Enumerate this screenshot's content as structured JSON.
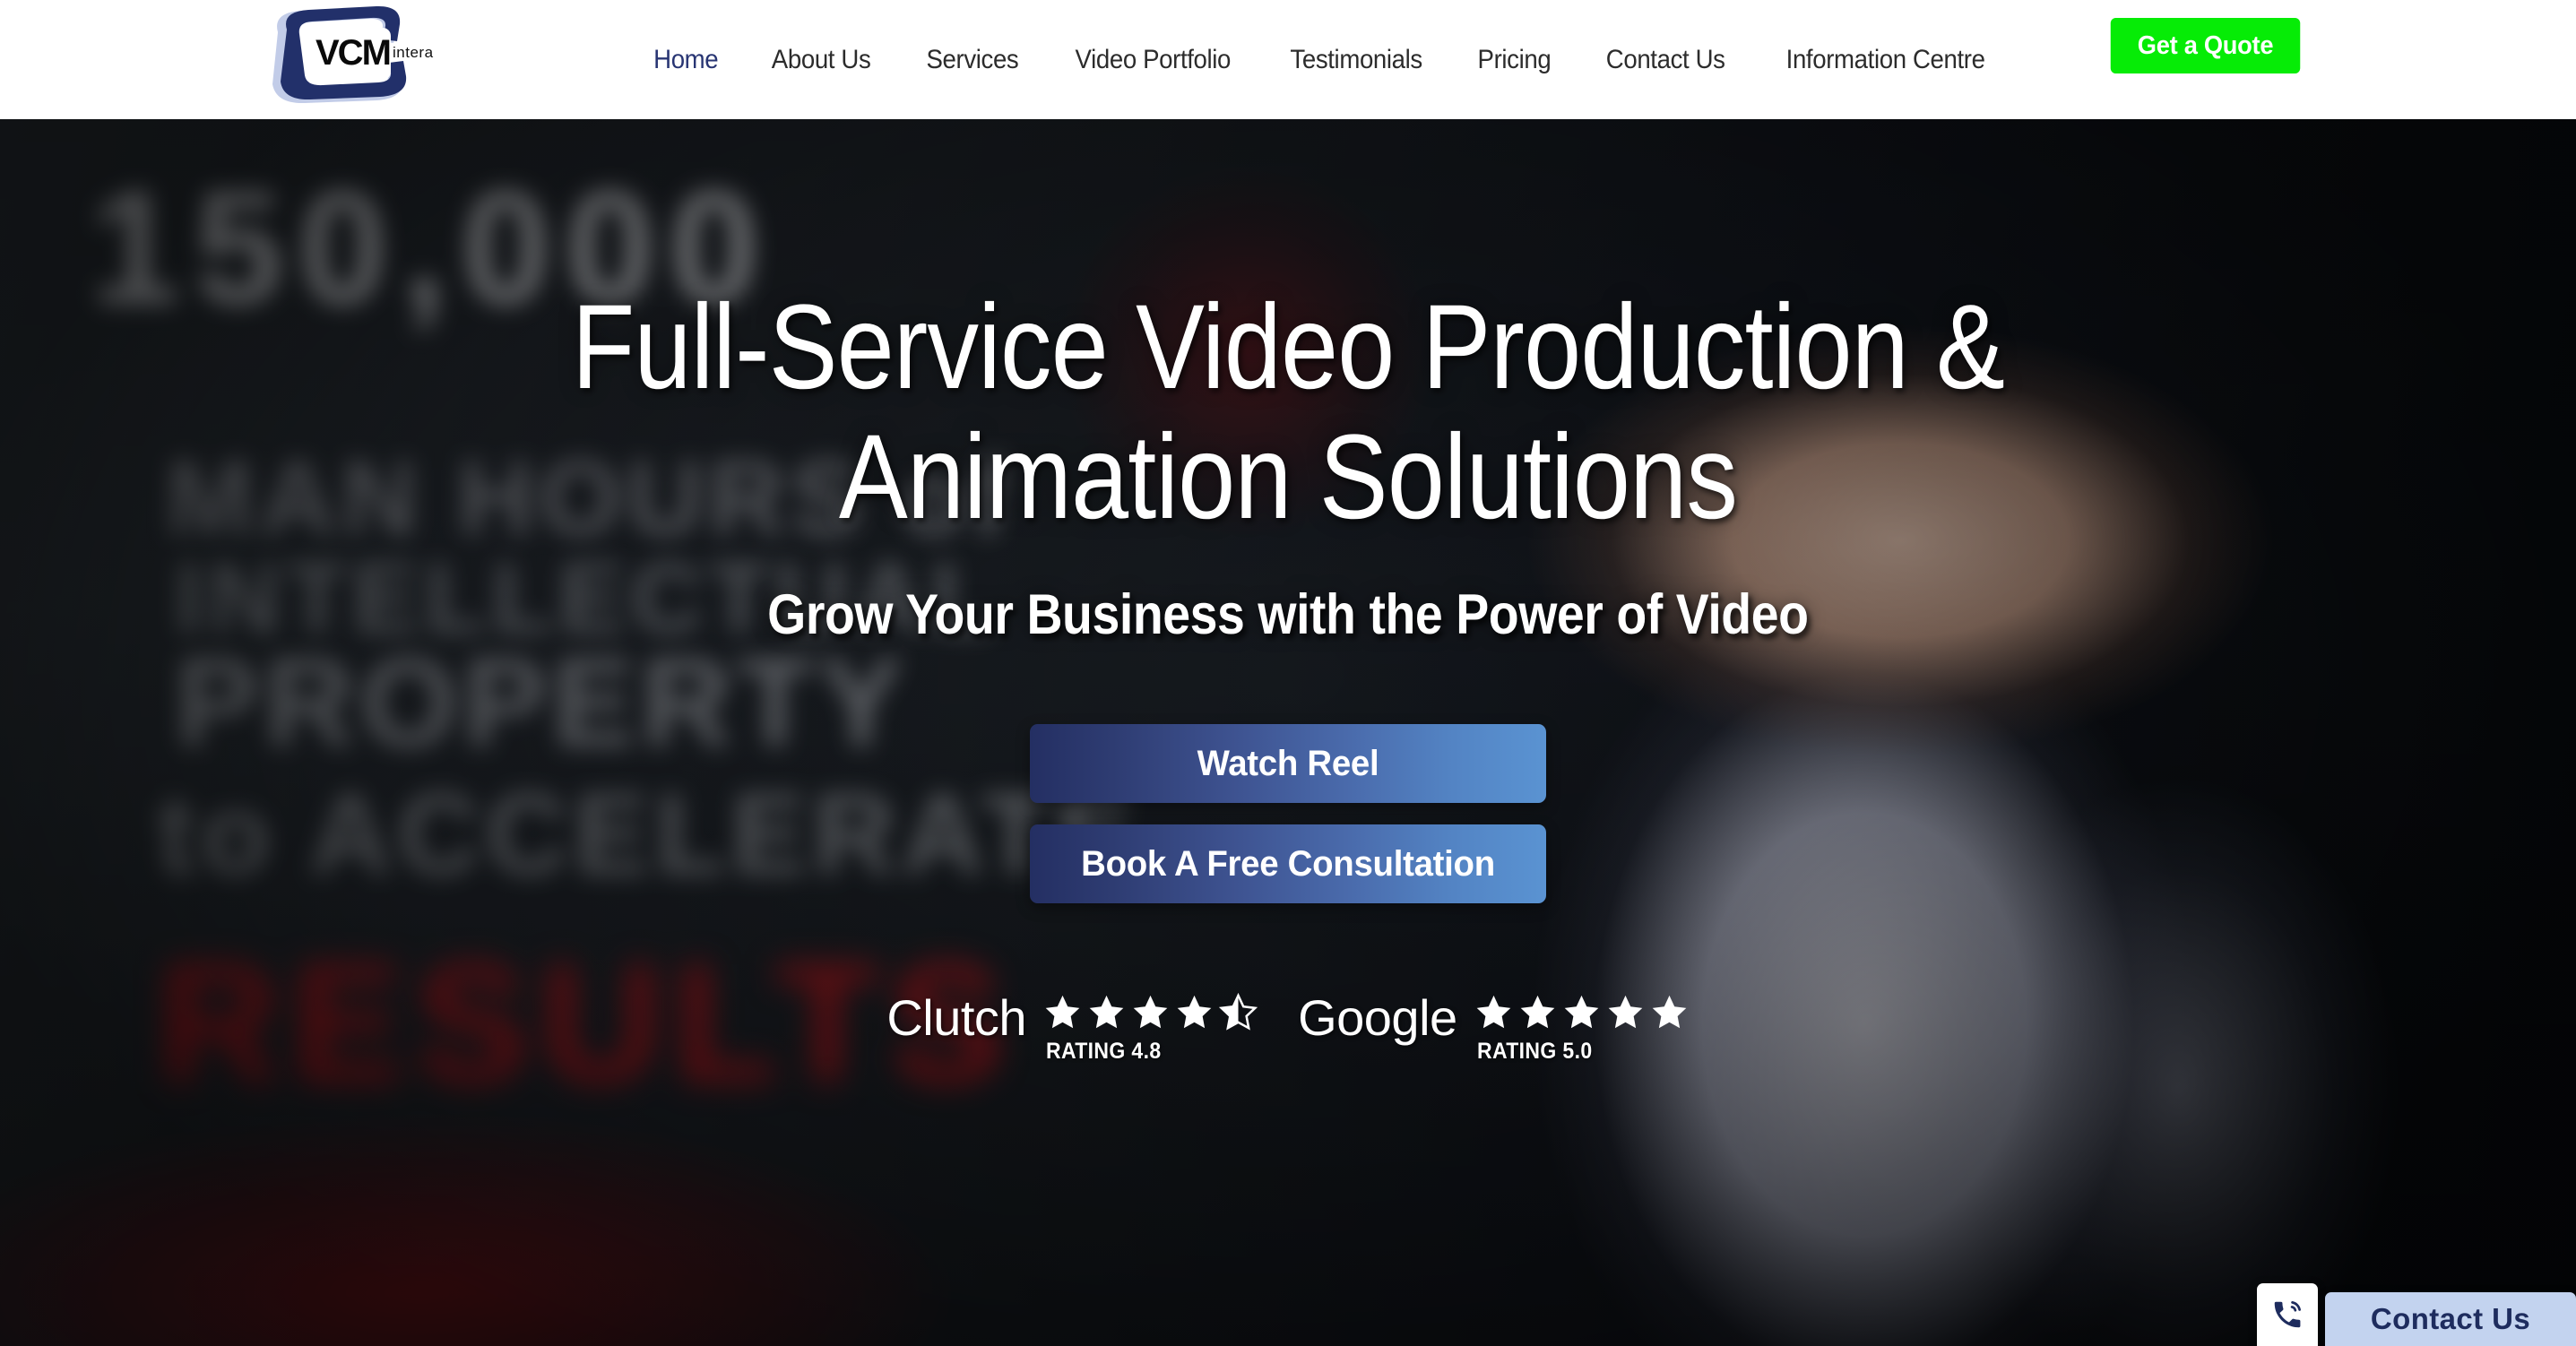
{
  "header": {
    "logo": {
      "brand": "VCM",
      "sub": "interactive",
      "alt": "VCM Interactive logo"
    },
    "nav_items": [
      {
        "label": "Home",
        "active": true
      },
      {
        "label": "About Us",
        "active": false
      },
      {
        "label": "Services",
        "active": false
      },
      {
        "label": "Video Portfolio",
        "active": false
      },
      {
        "label": "Testimonials",
        "active": false
      },
      {
        "label": "Pricing",
        "active": false
      },
      {
        "label": "Contact Us",
        "active": false
      },
      {
        "label": "Information Centre",
        "active": false
      }
    ],
    "quote_button_label": "Get a Quote",
    "quote_button_color": "#06ec06",
    "active_nav_color": "#283573",
    "nav_color": "#2c2c2c"
  },
  "hero": {
    "title_line_1": "Full-Service Video Production &",
    "title_line_2": "Animation Solutions",
    "subtitle": "Grow Your Business with the Power of Video",
    "buttons": [
      {
        "label": "Watch Reel"
      },
      {
        "label": "Book A Free Consultation"
      }
    ],
    "button_gradient_start": "#242f63",
    "button_gradient_end": "#5a93d2",
    "background_text": {
      "line_1": "150,000",
      "line_2": "MAN HOURS of",
      "line_3": "INTELLECTUAL",
      "line_4": "PROPERTY",
      "line_5": "to ACCELERATE",
      "line_6": "RESULTS"
    }
  },
  "ratings": [
    {
      "brand": "Clutch",
      "brand_name": "clutch",
      "stars_full": 4,
      "stars_half": 1,
      "stars_empty": 0,
      "label": "RATING 4.8",
      "value": 4.8
    },
    {
      "brand": "Google",
      "brand_name": "google",
      "stars_full": 5,
      "stars_half": 0,
      "stars_empty": 0,
      "label": "RATING 5.0",
      "value": 5.0
    }
  ],
  "contact_widget": {
    "phone_icon": "phone-call-icon",
    "button_label": "Contact Us",
    "pill_color": "#c3d3ef",
    "text_color": "#1e2c5e"
  }
}
